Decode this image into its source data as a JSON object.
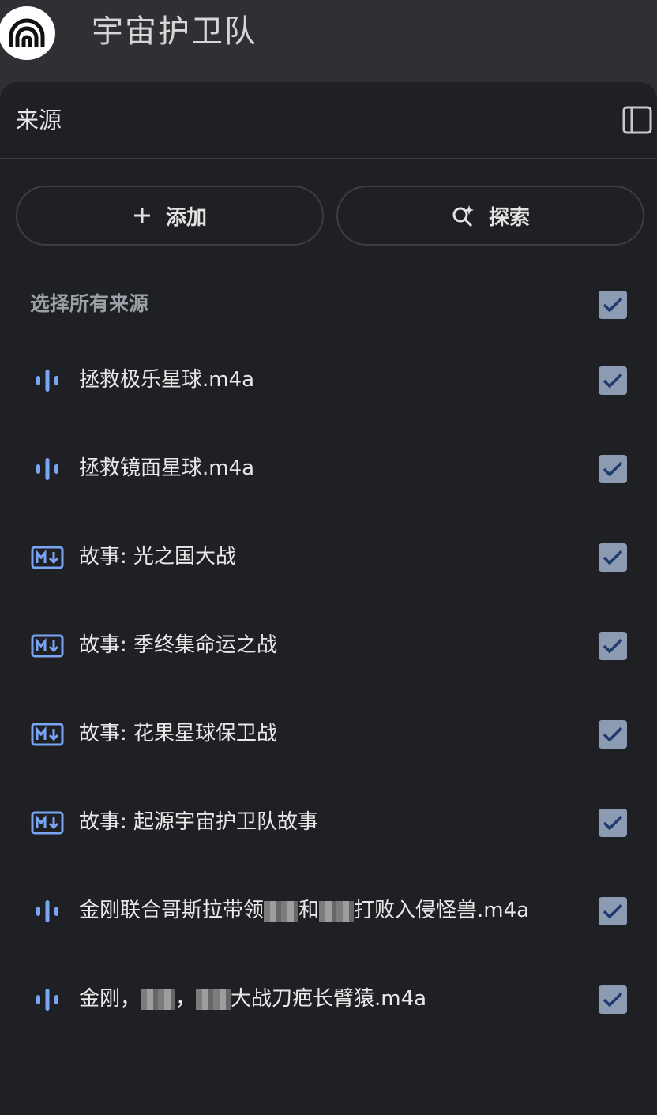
{
  "app": {
    "title": "宇宙护卫队"
  },
  "panel": {
    "title": "来源"
  },
  "actions": {
    "add_label": "添加",
    "explore_label": "探索"
  },
  "select_all": {
    "label": "选择所有来源",
    "checked": true
  },
  "colors": {
    "accent": "#7aa5f5",
    "checkbox_bg": "#8d9bb2",
    "check_mark": "#1f3a6e",
    "panel_bg": "#1f2024"
  },
  "sources": [
    {
      "icon": "audio-waveform-icon",
      "name": "拯救极乐星球.m4a",
      "checked": true
    },
    {
      "icon": "audio-waveform-icon",
      "name": "拯救镜面星球.m4a",
      "checked": true
    },
    {
      "icon": "markdown-icon",
      "name": "故事: 光之国大战",
      "checked": true
    },
    {
      "icon": "markdown-icon",
      "name": "故事: 季终集命运之战",
      "checked": true
    },
    {
      "icon": "markdown-icon",
      "name": "故事: 花果星球保卫战",
      "checked": true
    },
    {
      "icon": "markdown-icon",
      "name": "故事: 起源宇宙护卫队故事",
      "checked": true
    },
    {
      "icon": "audio-waveform-icon",
      "name_parts": [
        "金刚联合哥斯拉带领",
        "和",
        "打败入侵怪兽.m4a"
      ],
      "checked": true
    },
    {
      "icon": "audio-waveform-icon",
      "name_parts": [
        "金刚，",
        "，",
        "大战刀疤长臂猿.m4a"
      ],
      "checked": true
    }
  ]
}
